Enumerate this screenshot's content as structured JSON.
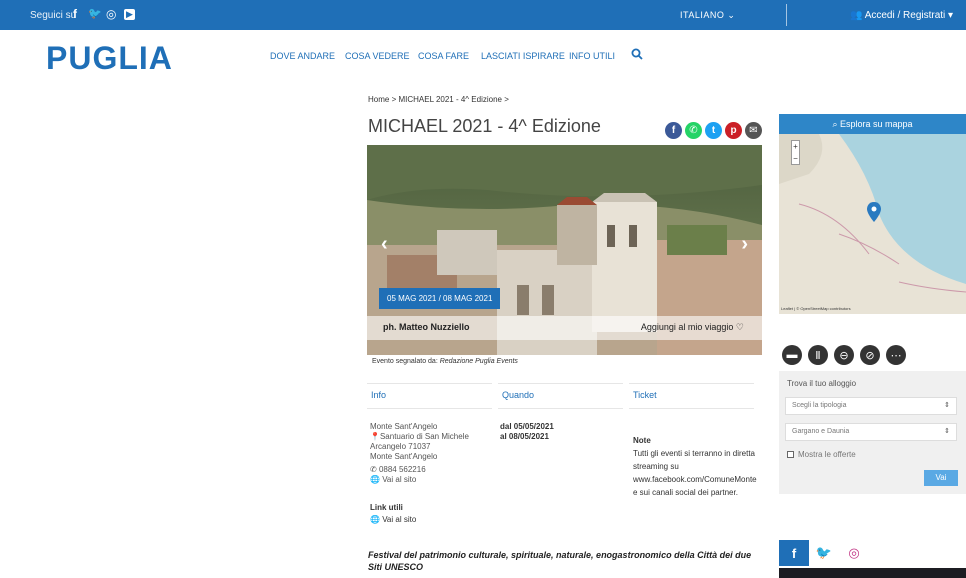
{
  "topbar": {
    "follow_label": "Seguici su",
    "social": [
      {
        "icon": "facebook-icon",
        "glyph": "f"
      },
      {
        "icon": "twitter-icon",
        "glyph": "🐦"
      },
      {
        "icon": "instagram-icon",
        "glyph": "◎"
      },
      {
        "icon": "youtube-icon",
        "glyph": "▶"
      }
    ],
    "language": "ITALIANO",
    "login_label": "Accedi / Registrati"
  },
  "header": {
    "logo": "PUGLIA",
    "nav": [
      "DOVE ANDARE",
      "COSA VEDERE",
      "COSA FARE",
      "LASCIATI ISPIRARE",
      "INFO UTILI"
    ]
  },
  "breadcrumb": "Home > MICHAEL 2021 - 4^ Edizione >",
  "event": {
    "title": "MICHAEL 2021 - 4^ Edizione",
    "dates_badge": "05 MAG 2021 / 08 MAG 2021",
    "photo_credit": "ph. Matteo Nuzziello",
    "add_trip": "Aggiungi al mio viaggio ♡",
    "reported_by_prefix": "Evento segnalato da: ",
    "reported_by": "Redazione Puglia Events"
  },
  "columns": {
    "info": "Info",
    "when": "Quando",
    "ticket": "Ticket"
  },
  "info": {
    "lines": [
      "Monte Sant'Angelo",
      "Santuario di San Michele",
      "Arcangelo 71037",
      "Monte Sant'Angelo",
      "0884 562216",
      "Vai al sito"
    ]
  },
  "when": {
    "from": "dal 05/05/2021",
    "to": "al 08/05/2021"
  },
  "note": {
    "title": "Note",
    "text": "Tutti gli eventi si terranno in diretta streaming su www.facebook.com/ComuneMonte e sui canali social dei partner."
  },
  "useful_links": {
    "title": "Link utili",
    "link": "Vai al sito"
  },
  "festival": "Festival del patrimonio culturale, spirituale, naturale, enogastronomico della Città dei due Siti UNESCO",
  "map": {
    "explore": "Esplora su mappa",
    "attribution": "Leaflet | © OpenStreetMap contributors"
  },
  "finder": {
    "label": "Trova il tuo alloggio",
    "select1": "Scegli la tipologia",
    "select2": "Gargano e Daunia",
    "checkbox": "Mostra le offerte",
    "button": "Vai"
  },
  "colors": {
    "brand": "#1f6fb7",
    "facebook": "#3b5998",
    "whatsapp": "#25d366",
    "twitter": "#1da1f2",
    "pinterest": "#cb2027",
    "email": "#555555",
    "instagram": "#c13584"
  }
}
